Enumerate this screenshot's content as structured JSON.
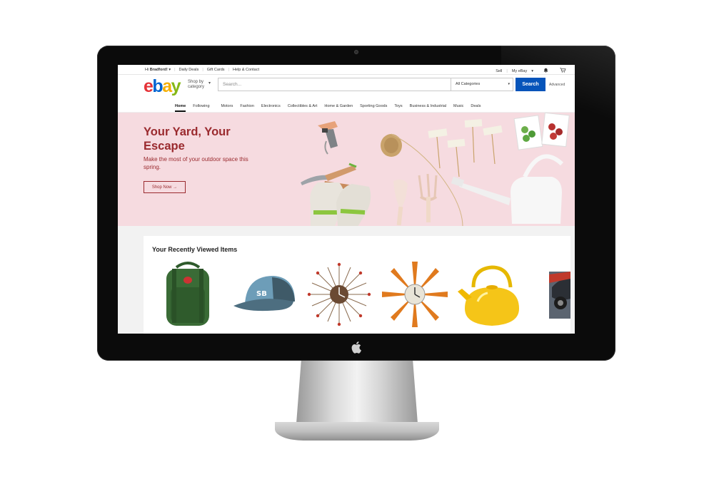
{
  "topbar": {
    "greeting": "Hi",
    "user": "Bradford!",
    "links": [
      "Daily Deals",
      "Gift Cards",
      "Help & Contact"
    ],
    "sell": "Sell",
    "my_ebay": "My eBay"
  },
  "header": {
    "logo": {
      "e": "e",
      "b": "b",
      "a": "a",
      "y": "y"
    },
    "shop_by_line1": "Shop by",
    "shop_by_line2": "category",
    "search_placeholder": "Search...",
    "category_selected": "All Categories",
    "search_button": "Search",
    "advanced": "Advanced"
  },
  "catnav": {
    "items": [
      "Home",
      "Following",
      "Motors",
      "Fashion",
      "Electronics",
      "Collectibles & Art",
      "Home & Garden",
      "Sporting Goods",
      "Toys",
      "Business & Industrial",
      "Music",
      "Deals"
    ]
  },
  "hero": {
    "title": "Your Yard, Your Escape",
    "subtitle": "Make the most of your outdoor space this spring.",
    "cta": "Shop Now →",
    "bg_color": "#f6dbe0",
    "text_color": "#9a2a2e"
  },
  "recent": {
    "title": "Your Recently Viewed Items",
    "items": [
      {
        "icon": "backpack-icon"
      },
      {
        "icon": "cap-icon"
      },
      {
        "icon": "starburst-clock-icon"
      },
      {
        "icon": "sunburst-clock-icon"
      },
      {
        "icon": "kettle-icon"
      },
      {
        "icon": "car-icon"
      }
    ]
  },
  "colors": {
    "ebay_red": "#e53238",
    "ebay_blue": "#0064d2",
    "ebay_yellow": "#f5af02",
    "ebay_green": "#86b817",
    "search_button": "#0654ba"
  }
}
